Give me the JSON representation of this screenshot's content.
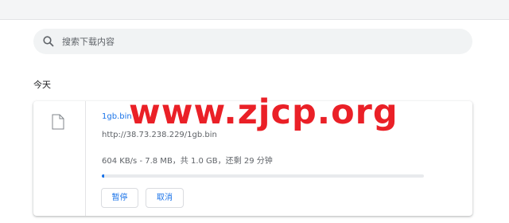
{
  "search": {
    "placeholder": "搜索下载内容",
    "icon": "search-icon"
  },
  "section": {
    "date_label": "今天"
  },
  "download": {
    "file_name": "1gb.bin",
    "url": "http://38.73.238.229/1gb.bin",
    "status": "604 KB/s - 7.8 MB，共 1.0 GB，还剩 29 分钟",
    "progress_fraction": 0.008,
    "file_icon": "file-icon",
    "buttons": {
      "pause": "暂停",
      "cancel": "取消"
    }
  },
  "watermark": {
    "text": "www.zjcp.org"
  },
  "colors": {
    "accent": "#1a73e8",
    "watermark": "#ea2027",
    "search_bg": "#f1f3f4"
  }
}
